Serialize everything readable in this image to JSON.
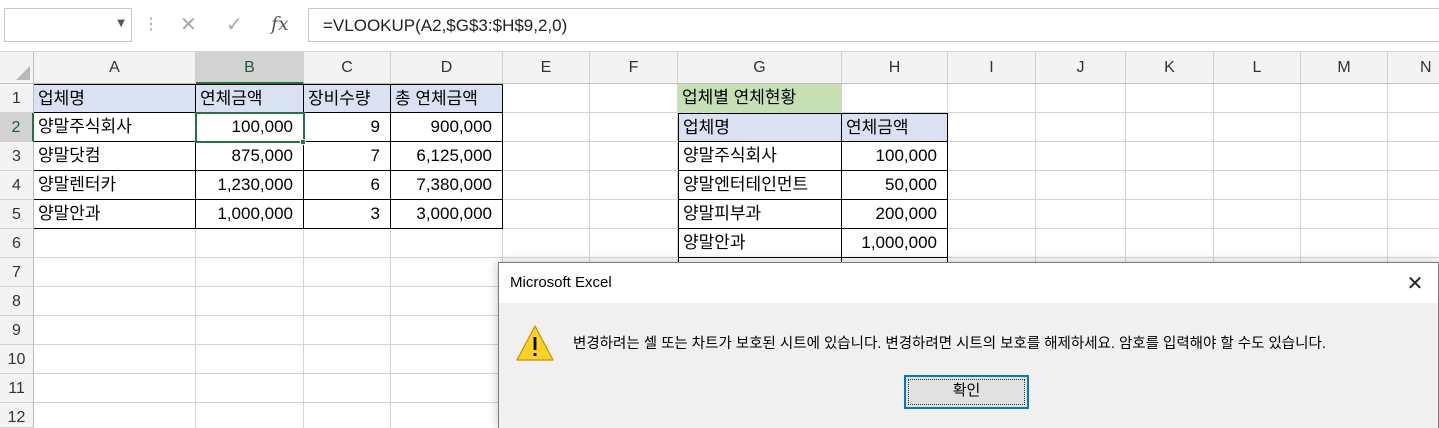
{
  "formula_bar": {
    "name_box_value": "",
    "formula": "=VLOOKUP(A2,$G$3:$H$9,2,0)",
    "icons": [
      "dropdown-arrow-icon",
      "more-options-icon",
      "cancel-icon",
      "enter-icon",
      "insert-function-icon"
    ]
  },
  "columns": [
    "A",
    "B",
    "C",
    "D",
    "E",
    "F",
    "G",
    "H",
    "I",
    "J",
    "K",
    "L",
    "M",
    "N"
  ],
  "rows": [
    "1",
    "2",
    "3",
    "4",
    "5",
    "6",
    "7",
    "8",
    "9",
    "10",
    "11",
    "12"
  ],
  "active_cell": "B2",
  "table1": {
    "headers": [
      "업체명",
      "연체금액",
      "장비수량",
      "총 연체금액"
    ],
    "rows": [
      [
        "양말주식회사",
        "100,000",
        "9",
        "900,000"
      ],
      [
        "양말닷컴",
        "875,000",
        "7",
        "6,125,000"
      ],
      [
        "양말렌터카",
        "1,230,000",
        "6",
        "7,380,000"
      ],
      [
        "양말안과",
        "1,000,000",
        "3",
        "3,000,000"
      ]
    ]
  },
  "table2": {
    "title": "업체별 연체현황",
    "headers": [
      "업체명",
      "연체금액"
    ],
    "rows": [
      [
        "양말주식회사",
        "100,000"
      ],
      [
        "양말엔터테인먼트",
        "50,000"
      ],
      [
        "양말피부과",
        "200,000"
      ],
      [
        "양말안과",
        "1,000,000"
      ]
    ]
  },
  "dialog": {
    "title": "Microsoft Excel",
    "message": "변경하려는 셀 또는 차트가 보호된 시트에 있습니다. 변경하려면 시트의 보호를 해제하세요. 암호를 입력해야 할 수도 있습니다.",
    "ok_label": "확인",
    "icon": "warning-icon",
    "close_icon": "close-icon"
  },
  "colors": {
    "header_fill": "#d9e1f2",
    "title_fill": "#c6e0b4",
    "selection": "#217346",
    "button_focus": "#0078d7"
  }
}
